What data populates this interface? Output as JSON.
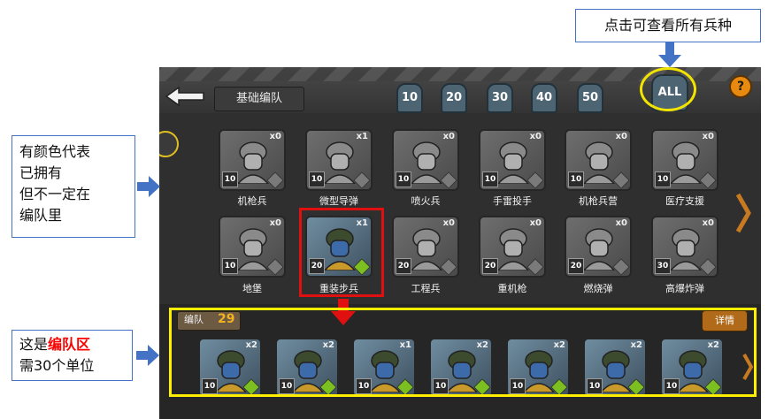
{
  "header": {
    "title": "基础编队",
    "level_tabs": [
      "10",
      "20",
      "30",
      "40",
      "50"
    ],
    "all_label": "ALL",
    "help_label": "?"
  },
  "units_row1": [
    {
      "name": "机枪兵",
      "count": "x0",
      "level": "10",
      "owned": false
    },
    {
      "name": "微型导弹",
      "count": "x1",
      "level": "10",
      "owned": false
    },
    {
      "name": "喷火兵",
      "count": "x0",
      "level": "10",
      "owned": false
    },
    {
      "name": "手雷投手",
      "count": "x0",
      "level": "10",
      "owned": false
    },
    {
      "name": "机枪兵营",
      "count": "x0",
      "level": "10",
      "owned": false
    },
    {
      "name": "医疗支援",
      "count": "x0",
      "level": "10",
      "owned": false
    }
  ],
  "units_row2": [
    {
      "name": "地堡",
      "count": "x0",
      "level": "10",
      "owned": false
    },
    {
      "name": "重装步兵",
      "count": "x1",
      "level": "20",
      "owned": true
    },
    {
      "name": "工程兵",
      "count": "x0",
      "level": "20",
      "owned": false
    },
    {
      "name": "重机枪",
      "count": "x0",
      "level": "20",
      "owned": false
    },
    {
      "name": "燃烧弹",
      "count": "x0",
      "level": "20",
      "owned": false
    },
    {
      "name": "高爆炸弹",
      "count": "x0",
      "level": "30",
      "owned": false
    }
  ],
  "team": {
    "label": "编队",
    "count": "29",
    "detail_label": "详情",
    "cards": [
      {
        "count": "x2",
        "level": "10"
      },
      {
        "count": "x2",
        "level": "10"
      },
      {
        "count": "x1",
        "level": "10"
      },
      {
        "count": "x2",
        "level": "10"
      },
      {
        "count": "x2",
        "level": "10"
      },
      {
        "count": "x2",
        "level": "10"
      },
      {
        "count": "x2",
        "level": "10"
      }
    ]
  },
  "annotations": {
    "top": "点击可查看所有兵种",
    "left_lines": [
      "有颜色代表",
      "已拥有",
      "但不一定在",
      "编队里"
    ],
    "bottom_prefix": "这是",
    "bottom_highlight": "编队区",
    "bottom_line2": "需30个单位"
  },
  "colors": {
    "highlight_red": "#e01010",
    "highlight_yellow": "#ffee00",
    "callout_border": "#4472c4",
    "arrow_blue": "#4472c4",
    "team_count": "#f4b220"
  }
}
